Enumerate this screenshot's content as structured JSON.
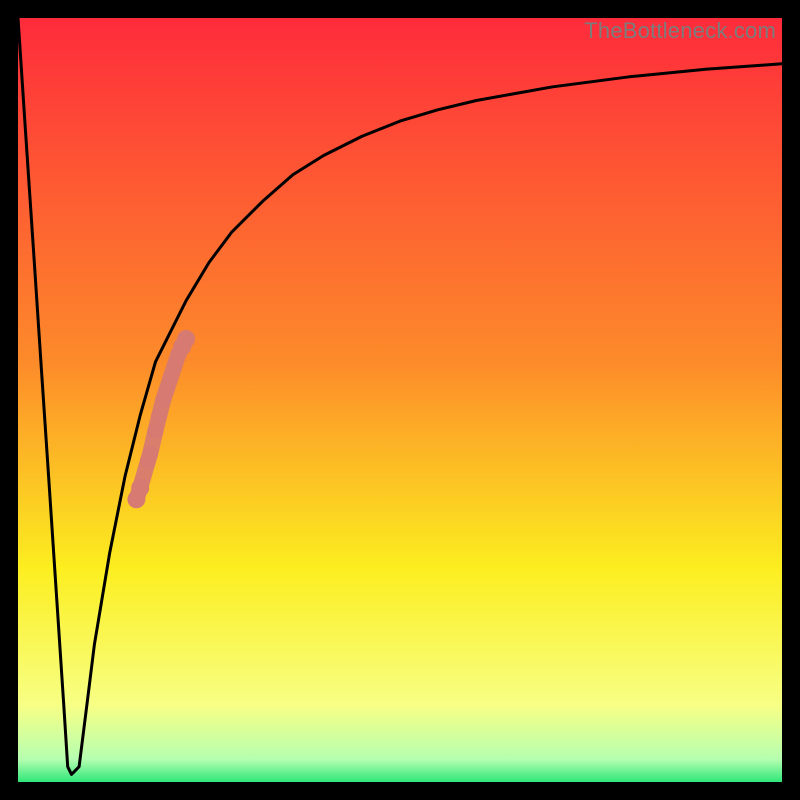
{
  "watermark": "TheBottleneck.com",
  "colors": {
    "frame": "#000000",
    "grad_top": "#fe2b3b",
    "grad_mid1": "#fd8b2a",
    "grad_mid2": "#fcee1f",
    "grad_low": "#f7ff85",
    "grad_base": "#2fe67a",
    "curve": "#000000",
    "marker": "#d77a71"
  },
  "chart_data": {
    "type": "line",
    "title": "",
    "xlabel": "",
    "ylabel": "",
    "xlim": [
      0,
      100
    ],
    "ylim": [
      0,
      100
    ],
    "grid": false,
    "legend": false,
    "series": [
      {
        "name": "bottleneck-curve",
        "x": [
          0,
          1,
          2,
          3,
          4,
          5,
          6,
          6.5,
          7,
          8,
          9,
          10,
          12,
          14,
          16,
          18,
          20,
          22,
          25,
          28,
          32,
          36,
          40,
          45,
          50,
          55,
          60,
          70,
          80,
          90,
          100
        ],
        "y": [
          100,
          85,
          70,
          55,
          40,
          25,
          10,
          2,
          1,
          2,
          10,
          18,
          30,
          40,
          48,
          55,
          59,
          63,
          68,
          72,
          76,
          79.5,
          82,
          84.5,
          86.5,
          88,
          89.2,
          91,
          92.3,
          93.3,
          94
        ]
      }
    ],
    "markers": {
      "name": "highlight-segment",
      "points": [
        {
          "x": 15.5,
          "y": 37.0
        },
        {
          "x": 16.0,
          "y": 38.5
        },
        {
          "x": 17.0,
          "y": 42.0
        },
        {
          "x": 17.3,
          "y": 43.0
        },
        {
          "x": 18.0,
          "y": 46.0
        },
        {
          "x": 18.5,
          "y": 48.0
        },
        {
          "x": 19.0,
          "y": 50.0
        },
        {
          "x": 19.5,
          "y": 51.5
        },
        {
          "x": 20.0,
          "y": 53.0
        },
        {
          "x": 20.5,
          "y": 54.5
        },
        {
          "x": 21.0,
          "y": 56.0
        },
        {
          "x": 21.5,
          "y": 57.0
        },
        {
          "x": 22.0,
          "y": 58.0
        }
      ]
    },
    "gradient_stops": [
      {
        "offset": 0,
        "value": 100
      },
      {
        "offset": 45,
        "value": 55
      },
      {
        "offset": 72,
        "value": 28
      },
      {
        "offset": 90,
        "value": 10
      },
      {
        "offset": 97,
        "value": 3
      },
      {
        "offset": 100,
        "value": 0
      }
    ]
  }
}
